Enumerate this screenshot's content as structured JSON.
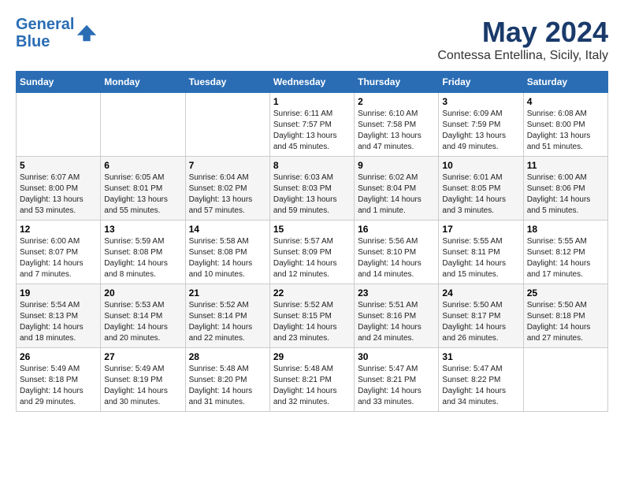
{
  "logo": {
    "line1": "General",
    "line2": "Blue"
  },
  "title": "May 2024",
  "subtitle": "Contessa Entellina, Sicily, Italy",
  "days_of_week": [
    "Sunday",
    "Monday",
    "Tuesday",
    "Wednesday",
    "Thursday",
    "Friday",
    "Saturday"
  ],
  "weeks": [
    [
      {
        "day": "",
        "info": ""
      },
      {
        "day": "",
        "info": ""
      },
      {
        "day": "",
        "info": ""
      },
      {
        "day": "1",
        "info": "Sunrise: 6:11 AM\nSunset: 7:57 PM\nDaylight: 13 hours and 45 minutes."
      },
      {
        "day": "2",
        "info": "Sunrise: 6:10 AM\nSunset: 7:58 PM\nDaylight: 13 hours and 47 minutes."
      },
      {
        "day": "3",
        "info": "Sunrise: 6:09 AM\nSunset: 7:59 PM\nDaylight: 13 hours and 49 minutes."
      },
      {
        "day": "4",
        "info": "Sunrise: 6:08 AM\nSunset: 8:00 PM\nDaylight: 13 hours and 51 minutes."
      }
    ],
    [
      {
        "day": "5",
        "info": "Sunrise: 6:07 AM\nSunset: 8:00 PM\nDaylight: 13 hours and 53 minutes."
      },
      {
        "day": "6",
        "info": "Sunrise: 6:05 AM\nSunset: 8:01 PM\nDaylight: 13 hours and 55 minutes."
      },
      {
        "day": "7",
        "info": "Sunrise: 6:04 AM\nSunset: 8:02 PM\nDaylight: 13 hours and 57 minutes."
      },
      {
        "day": "8",
        "info": "Sunrise: 6:03 AM\nSunset: 8:03 PM\nDaylight: 13 hours and 59 minutes."
      },
      {
        "day": "9",
        "info": "Sunrise: 6:02 AM\nSunset: 8:04 PM\nDaylight: 14 hours and 1 minute."
      },
      {
        "day": "10",
        "info": "Sunrise: 6:01 AM\nSunset: 8:05 PM\nDaylight: 14 hours and 3 minutes."
      },
      {
        "day": "11",
        "info": "Sunrise: 6:00 AM\nSunset: 8:06 PM\nDaylight: 14 hours and 5 minutes."
      }
    ],
    [
      {
        "day": "12",
        "info": "Sunrise: 6:00 AM\nSunset: 8:07 PM\nDaylight: 14 hours and 7 minutes."
      },
      {
        "day": "13",
        "info": "Sunrise: 5:59 AM\nSunset: 8:08 PM\nDaylight: 14 hours and 8 minutes."
      },
      {
        "day": "14",
        "info": "Sunrise: 5:58 AM\nSunset: 8:08 PM\nDaylight: 14 hours and 10 minutes."
      },
      {
        "day": "15",
        "info": "Sunrise: 5:57 AM\nSunset: 8:09 PM\nDaylight: 14 hours and 12 minutes."
      },
      {
        "day": "16",
        "info": "Sunrise: 5:56 AM\nSunset: 8:10 PM\nDaylight: 14 hours and 14 minutes."
      },
      {
        "day": "17",
        "info": "Sunrise: 5:55 AM\nSunset: 8:11 PM\nDaylight: 14 hours and 15 minutes."
      },
      {
        "day": "18",
        "info": "Sunrise: 5:55 AM\nSunset: 8:12 PM\nDaylight: 14 hours and 17 minutes."
      }
    ],
    [
      {
        "day": "19",
        "info": "Sunrise: 5:54 AM\nSunset: 8:13 PM\nDaylight: 14 hours and 18 minutes."
      },
      {
        "day": "20",
        "info": "Sunrise: 5:53 AM\nSunset: 8:14 PM\nDaylight: 14 hours and 20 minutes."
      },
      {
        "day": "21",
        "info": "Sunrise: 5:52 AM\nSunset: 8:14 PM\nDaylight: 14 hours and 22 minutes."
      },
      {
        "day": "22",
        "info": "Sunrise: 5:52 AM\nSunset: 8:15 PM\nDaylight: 14 hours and 23 minutes."
      },
      {
        "day": "23",
        "info": "Sunrise: 5:51 AM\nSunset: 8:16 PM\nDaylight: 14 hours and 24 minutes."
      },
      {
        "day": "24",
        "info": "Sunrise: 5:50 AM\nSunset: 8:17 PM\nDaylight: 14 hours and 26 minutes."
      },
      {
        "day": "25",
        "info": "Sunrise: 5:50 AM\nSunset: 8:18 PM\nDaylight: 14 hours and 27 minutes."
      }
    ],
    [
      {
        "day": "26",
        "info": "Sunrise: 5:49 AM\nSunset: 8:18 PM\nDaylight: 14 hours and 29 minutes."
      },
      {
        "day": "27",
        "info": "Sunrise: 5:49 AM\nSunset: 8:19 PM\nDaylight: 14 hours and 30 minutes."
      },
      {
        "day": "28",
        "info": "Sunrise: 5:48 AM\nSunset: 8:20 PM\nDaylight: 14 hours and 31 minutes."
      },
      {
        "day": "29",
        "info": "Sunrise: 5:48 AM\nSunset: 8:21 PM\nDaylight: 14 hours and 32 minutes."
      },
      {
        "day": "30",
        "info": "Sunrise: 5:47 AM\nSunset: 8:21 PM\nDaylight: 14 hours and 33 minutes."
      },
      {
        "day": "31",
        "info": "Sunrise: 5:47 AM\nSunset: 8:22 PM\nDaylight: 14 hours and 34 minutes."
      },
      {
        "day": "",
        "info": ""
      }
    ]
  ]
}
